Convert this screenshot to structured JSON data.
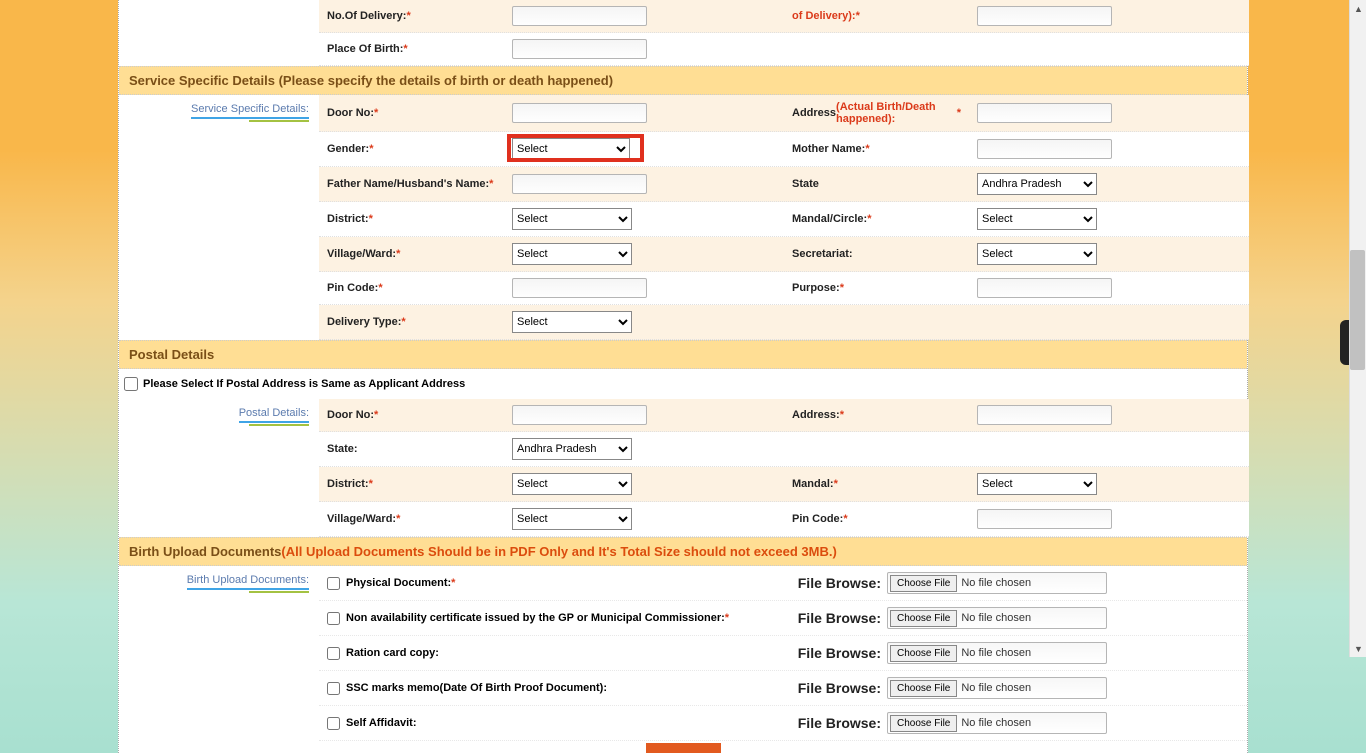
{
  "top": {
    "no_delivery": "No.Of Delivery:",
    "of_delivery": "of Delivery):",
    "place_birth": "Place Of Birth:"
  },
  "service": {
    "header": "Service Specific Details (Please specify the details of birth or death happened)",
    "sidebar": "Service Specific Details:",
    "door": "Door No:",
    "address": "Address",
    "address_note": "(Actual Birth/Death happened):",
    "gender": "Gender:",
    "gender_opt": "Select",
    "mother": "Mother Name:",
    "father": "Father Name/Husband's Name:",
    "state": "State",
    "state_opt": "Andhra Pradesh",
    "district": "District:",
    "district_opt": "Select",
    "mandal": "Mandal/Circle:",
    "mandal_opt": "Select",
    "village": "Village/Ward:",
    "village_opt": "Select",
    "secretariat": "Secretariat:",
    "secretariat_opt": "Select",
    "pincode": "Pin Code:",
    "purpose": "Purpose:",
    "delivery_type": "Delivery Type:",
    "delivery_opt": "Select"
  },
  "postal": {
    "header": "Postal Details",
    "checkbox": "Please Select If Postal Address is Same as Applicant Address",
    "sidebar": "Postal Details:",
    "door": "Door No:",
    "address": "Address:",
    "state": "State:",
    "state_opt": "Andhra Pradesh",
    "district": "District:",
    "district_opt": "Select",
    "mandal": "Mandal:",
    "mandal_opt": "Select",
    "village": "Village/Ward:",
    "village_opt": "Select",
    "pincode": "Pin Code:"
  },
  "upload": {
    "header_main": "Birth Upload Documents",
    "header_note": "(All Upload Documents Should be in PDF Only and It's Total Size should not exceed 3MB.)",
    "sidebar": "Birth Upload Documents:",
    "file_browse": "File Browse:",
    "choose": "Choose File",
    "nofile": "No file chosen",
    "docs": [
      {
        "label": "Physical Document:",
        "req": true
      },
      {
        "label": "Non availability certificate issued by the GP or Municipal Commissioner:",
        "req": true
      },
      {
        "label": "Ration card copy:",
        "req": false
      },
      {
        "label": "SSC marks memo(Date Of Birth Proof Document):",
        "req": false
      },
      {
        "label": "Self Affidavit:",
        "req": false
      }
    ]
  }
}
